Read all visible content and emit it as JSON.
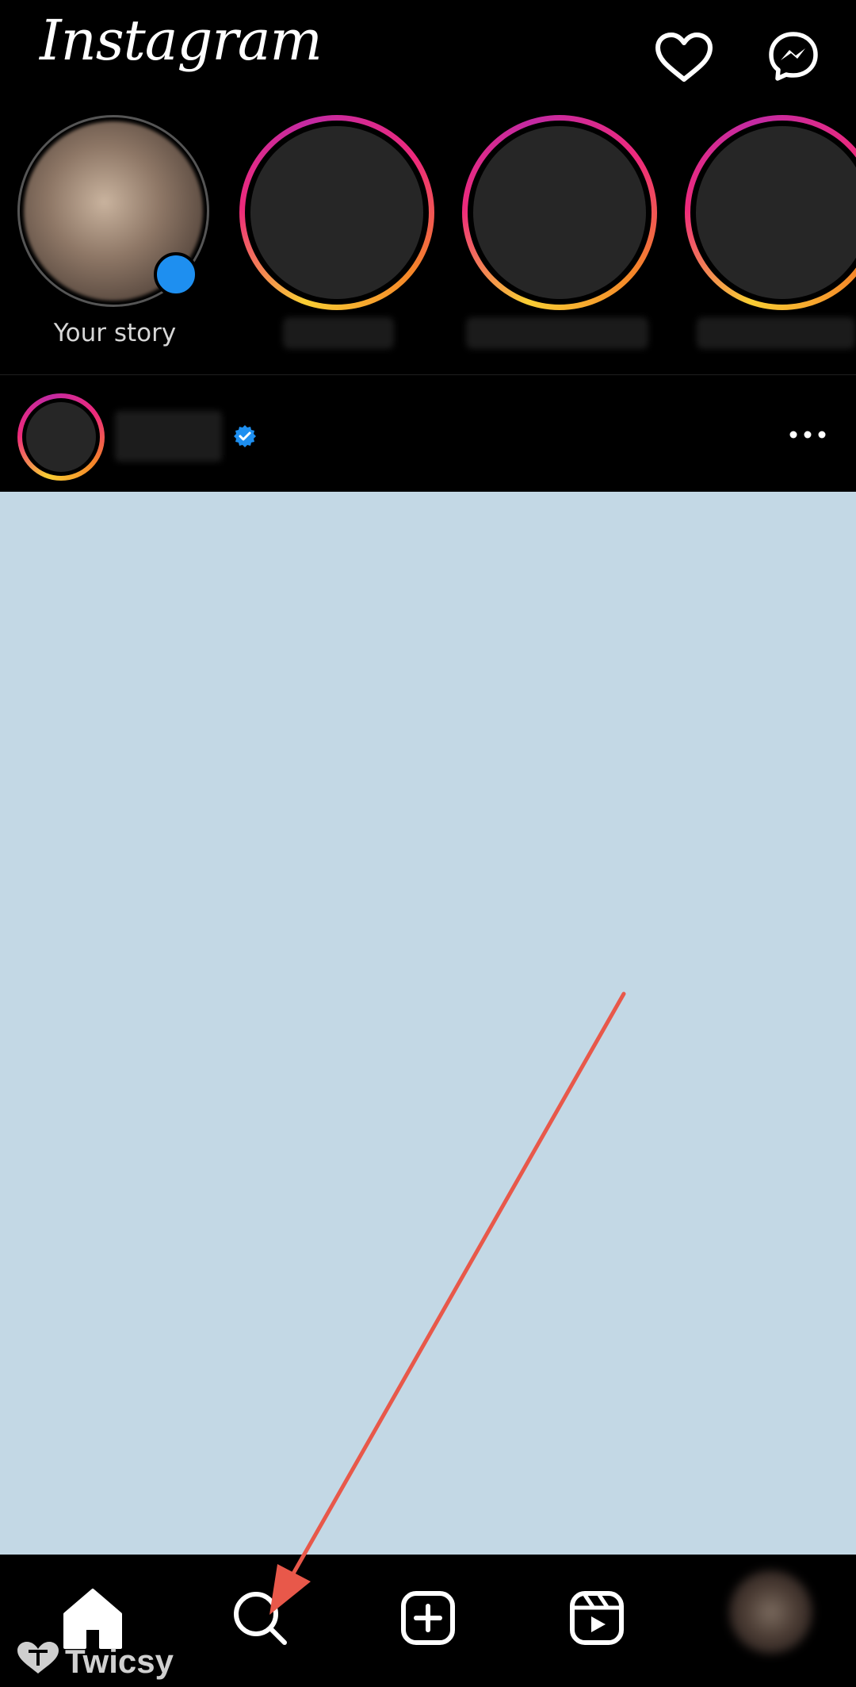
{
  "header": {
    "logo": "Instagram",
    "icons": [
      "heart-icon",
      "messenger-icon"
    ]
  },
  "stories": {
    "own_label": "Your story",
    "others_count": 3
  },
  "post": {
    "verified": true,
    "icons": [
      "verified-badge-icon",
      "more-options-icon"
    ]
  },
  "nav": {
    "icons": [
      "home-icon",
      "search-icon",
      "create-post-icon",
      "reels-icon"
    ]
  },
  "watermark": {
    "text": "Twicsy"
  },
  "colors": {
    "background": "#000000",
    "post_image": "#c3d8e5",
    "arrow": "#e8584a",
    "verified": "#1e8ff0"
  }
}
